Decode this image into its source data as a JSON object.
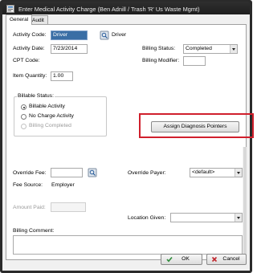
{
  "window": {
    "title": "Enter Medical Activity Charge (Ben Adnill / Trash 'R' Us Waste Mgmt)"
  },
  "tabs": [
    {
      "label": "General",
      "active": true
    },
    {
      "label": "Audit",
      "active": false
    }
  ],
  "form": {
    "activity_code": {
      "label": "Activity Code:",
      "value": "Driver",
      "display": "Driver"
    },
    "activity_date": {
      "label": "Activity Date:",
      "value": "7/23/2014"
    },
    "cpt_code": {
      "label": "CPT Code:",
      "value": ""
    },
    "item_quantity": {
      "label": "Item Quantity:",
      "value": "1.00"
    },
    "billing_status": {
      "label": "Billing Status:",
      "value": "Completed"
    },
    "billing_modifier": {
      "label": "Billing Modifier:",
      "value": ""
    },
    "billable_status": {
      "label": "Billable Status:",
      "options": [
        {
          "label": "Billable Activity",
          "checked": true,
          "disabled": false
        },
        {
          "label": "No Charge Activity",
          "checked": false,
          "disabled": false
        },
        {
          "label": "Billing Completed",
          "checked": false,
          "disabled": true
        }
      ]
    },
    "assign_button": "Assign Diagnosis Pointers",
    "override_fee": {
      "label": "Override Fee:",
      "value": ""
    },
    "override_payer": {
      "label": "Override Payer:",
      "value": "<default>"
    },
    "fee_source": {
      "label": "Fee Source:",
      "value": "Employer"
    },
    "amount_paid": {
      "label": "Amount Paid:",
      "value": ""
    },
    "location_given": {
      "label": "Location Given:",
      "value": ""
    },
    "billing_comment": {
      "label": "Billing Comment:",
      "value": ""
    }
  },
  "buttons": {
    "ok": "OK",
    "cancel": "Cancel"
  },
  "colors": {
    "highlight": "#d01f2c",
    "selection": "#3a6ea5"
  }
}
